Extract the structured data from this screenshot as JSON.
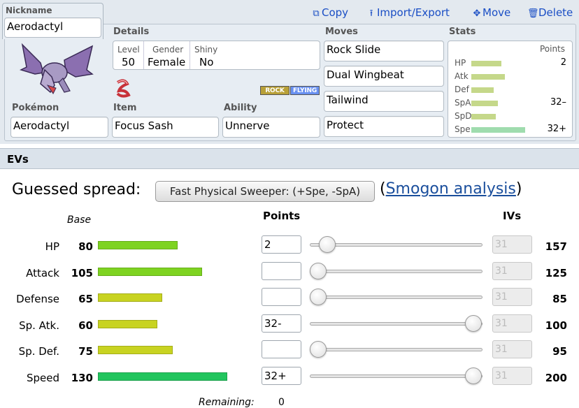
{
  "nickname": {
    "label": "Nickname",
    "value": "Aerodactyl"
  },
  "actions": {
    "copy": "Copy",
    "import_export": "Import/Export",
    "move": "Move",
    "delete": "Delete"
  },
  "details": {
    "title": "Details",
    "level_label": "Level",
    "level": "50",
    "gender_label": "Gender",
    "gender": "Female",
    "shiny_label": "Shiny",
    "shiny": "No"
  },
  "types": [
    "ROCK",
    "FLYING"
  ],
  "pokemon": {
    "label": "Pokémon",
    "value": "Aerodactyl"
  },
  "item": {
    "label": "Item",
    "value": "Focus Sash"
  },
  "ability": {
    "label": "Ability",
    "value": "Unnerve"
  },
  "moves": {
    "title": "Moves",
    "list": [
      "Rock Slide",
      "Dual Wingbeat",
      "Tailwind",
      "Protect"
    ]
  },
  "stats_summary": {
    "title": "Stats",
    "points_label": "Points",
    "rows": [
      {
        "name": "HP",
        "points": "2",
        "fill": 0.31
      },
      {
        "name": "Atk",
        "points": "",
        "fill": 0.34
      },
      {
        "name": "Def",
        "points": "",
        "fill": 0.23
      },
      {
        "name": "SpA",
        "points": "32–",
        "fill": 0.27
      },
      {
        "name": "SpD",
        "points": "",
        "fill": 0.25
      },
      {
        "name": "Spe",
        "points": "32+",
        "fill": 0.55
      }
    ]
  },
  "evs": {
    "header": "EVs",
    "guessed_label": "Guessed spread:",
    "guessed_value": "Fast Physical Sweeper: (+Spe, -SpA)",
    "paren_open": "(",
    "smogon_link": "Smogon analysis",
    "paren_close": ")",
    "base_label": "Base",
    "points_label": "Points",
    "ivs_label": "IVs",
    "remaining_label": "Remaining:",
    "remaining_value": "0",
    "rows": [
      {
        "name": "HP",
        "base": "80",
        "points": "2",
        "iv": "31",
        "total": "157",
        "slider": 0.06
      },
      {
        "name": "Attack",
        "base": "105",
        "points": "",
        "iv": "31",
        "total": "125",
        "slider": 0
      },
      {
        "name": "Defense",
        "base": "65",
        "points": "",
        "iv": "31",
        "total": "85",
        "slider": 0
      },
      {
        "name": "Sp. Atk.",
        "base": "60",
        "points": "32-",
        "iv": "31",
        "total": "100",
        "slider": 1
      },
      {
        "name": "Sp. Def.",
        "base": "75",
        "points": "",
        "iv": "31",
        "total": "95",
        "slider": 0
      },
      {
        "name": "Speed",
        "base": "130",
        "points": "32+",
        "iv": "31",
        "total": "200",
        "slider": 1
      }
    ]
  },
  "colors": {
    "link": "#1a4ec5",
    "bar_green": "#7ed321",
    "bar_yellow": "#c8d321",
    "bar_speed": "#22c55e"
  }
}
